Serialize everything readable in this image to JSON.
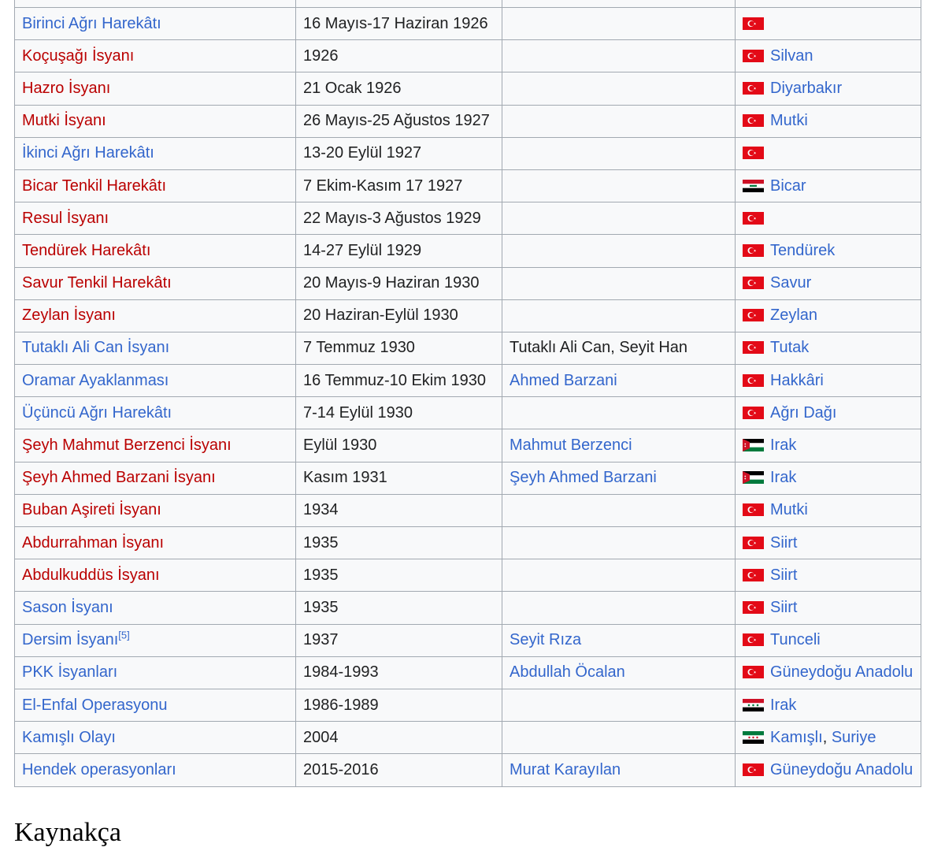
{
  "table": {
    "rows": [
      {
        "name": "Birinci Ağrı Harekâtı",
        "name_style": "blue",
        "date": "16 Mayıs-17 Haziran 1926",
        "leader": "",
        "leader_style": "",
        "flag": "turkey-flag",
        "places": []
      },
      {
        "name": "Koçuşağı İsyanı",
        "name_style": "red",
        "date": "1926",
        "leader": "",
        "leader_style": "",
        "flag": "turkey-flag",
        "places": [
          "Silvan"
        ]
      },
      {
        "name": "Hazro İsyanı",
        "name_style": "red",
        "date": "21 Ocak 1926",
        "leader": "",
        "leader_style": "",
        "flag": "turkey-flag",
        "places": [
          "Diyarbakır"
        ]
      },
      {
        "name": "Mutki İsyanı",
        "name_style": "red",
        "date": "26 Mayıs-25 Ağustos 1927",
        "leader": "",
        "leader_style": "",
        "flag": "turkey-flag",
        "places": [
          "Mutki"
        ]
      },
      {
        "name": "İkinci Ağrı Harekâtı",
        "name_style": "blue",
        "date": "13-20 Eylül 1927",
        "leader": "",
        "leader_style": "",
        "flag": "turkey-flag",
        "places": []
      },
      {
        "name": "Bicar Tenkil Harekâtı",
        "name_style": "red",
        "date": "7 Ekim-Kasım 17 1927",
        "leader": "",
        "leader_style": "",
        "flag": "iraq-flag",
        "places": [
          "Bicar"
        ]
      },
      {
        "name": "Resul İsyanı",
        "name_style": "red",
        "date": "22 Mayıs-3 Ağustos 1929",
        "leader": "",
        "leader_style": "",
        "flag": "turkey-flag",
        "places": []
      },
      {
        "name": "Tendürek Harekâtı",
        "name_style": "red",
        "date": "14-27 Eylül 1929",
        "leader": "",
        "leader_style": "",
        "flag": "turkey-flag",
        "places": [
          "Tendürek"
        ]
      },
      {
        "name": "Savur Tenkil Harekâtı",
        "name_style": "red",
        "date": "20 Mayıs-9 Haziran 1930",
        "leader": "",
        "leader_style": "",
        "flag": "turkey-flag",
        "places": [
          "Savur"
        ]
      },
      {
        "name": "Zeylan İsyanı",
        "name_style": "red",
        "date": "20 Haziran-Eylül 1930",
        "leader": "",
        "leader_style": "",
        "flag": "turkey-flag",
        "places": [
          "Zeylan"
        ]
      },
      {
        "name": "Tutaklı Ali Can İsyanı",
        "name_style": "blue",
        "date": "7 Temmuz 1930",
        "leader": "Tutaklı Ali Can, Seyit Han",
        "leader_style": "plain",
        "flag": "turkey-flag",
        "places": [
          "Tutak"
        ]
      },
      {
        "name": "Oramar Ayaklanması",
        "name_style": "blue",
        "date": "16 Temmuz-10 Ekim 1930",
        "leader": "Ahmed Barzani",
        "leader_style": "blue",
        "flag": "turkey-flag",
        "places": [
          "Hakkâri"
        ]
      },
      {
        "name": "Üçüncü Ağrı Harekâtı",
        "name_style": "blue",
        "date": "7-14 Eylül 1930",
        "leader": "",
        "leader_style": "",
        "flag": "turkey-flag",
        "places": [
          "Ağrı Dağı"
        ]
      },
      {
        "name": "Şeyh Mahmut Berzenci İsyanı",
        "name_style": "red",
        "date": "Eylül 1930",
        "leader": "Mahmut Berzenci",
        "leader_style": "blue",
        "flag": "kingdom-iraq-flag",
        "places": [
          "Irak"
        ]
      },
      {
        "name": "Şeyh Ahmed Barzani İsyanı",
        "name_style": "red",
        "date": "Kasım 1931",
        "leader": "Şeyh Ahmed Barzani",
        "leader_style": "blue",
        "flag": "kingdom-iraq-flag",
        "places": [
          "Irak"
        ]
      },
      {
        "name": "Buban Aşireti İsyanı",
        "name_style": "red",
        "date": "1934",
        "leader": "",
        "leader_style": "",
        "flag": "turkey-flag",
        "places": [
          "Mutki"
        ]
      },
      {
        "name": "Abdurrahman İsyanı",
        "name_style": "red",
        "date": "1935",
        "leader": "",
        "leader_style": "",
        "flag": "turkey-flag",
        "places": [
          "Siirt"
        ]
      },
      {
        "name": "Abdulkuddüs İsyanı",
        "name_style": "red",
        "date": "1935",
        "leader": "",
        "leader_style": "",
        "flag": "turkey-flag",
        "places": [
          "Siirt"
        ]
      },
      {
        "name": "Sason İsyanı",
        "name_style": "blue",
        "date": "1935",
        "leader": "",
        "leader_style": "",
        "flag": "turkey-flag",
        "places": [
          "Siirt"
        ]
      },
      {
        "name": "Dersim İsyanı",
        "name_style": "blue",
        "name_sup": "[5]",
        "date": "1937",
        "leader": "Seyit Rıza",
        "leader_style": "blue",
        "flag": "turkey-flag",
        "places": [
          "Tunceli"
        ]
      },
      {
        "name": "PKK İsyanları",
        "name_style": "blue",
        "date": "1984-1993",
        "leader": "Abdullah Öcalan",
        "leader_style": "blue",
        "flag": "turkey-flag",
        "places": [
          "Güneydoğu Anadolu"
        ]
      },
      {
        "name": "El-Enfal Operasyonu",
        "name_style": "blue",
        "date": "1986-1989",
        "leader": "",
        "leader_style": "",
        "flag": "iraq-flag-stars",
        "places": [
          "Irak"
        ]
      },
      {
        "name": "Kamışlı Olayı",
        "name_style": "blue",
        "date": "2004",
        "leader": "",
        "leader_style": "",
        "flag": "syria-flag",
        "places": [
          "Kamışlı",
          "Suriye"
        ]
      },
      {
        "name": "Hendek operasyonları",
        "name_style": "blue",
        "date": "2015-2016",
        "leader": "Murat Karayılan",
        "leader_style": "blue",
        "flag": "turkey-flag",
        "places": [
          "Güneydoğu Anadolu"
        ]
      }
    ]
  },
  "footer": {
    "heading": "Kaynakça"
  },
  "colors": {
    "link_blue": "#3366cc",
    "link_red": "#ba0000",
    "border": "#a2a9b1",
    "cell_bg": "#f8f9fa"
  }
}
